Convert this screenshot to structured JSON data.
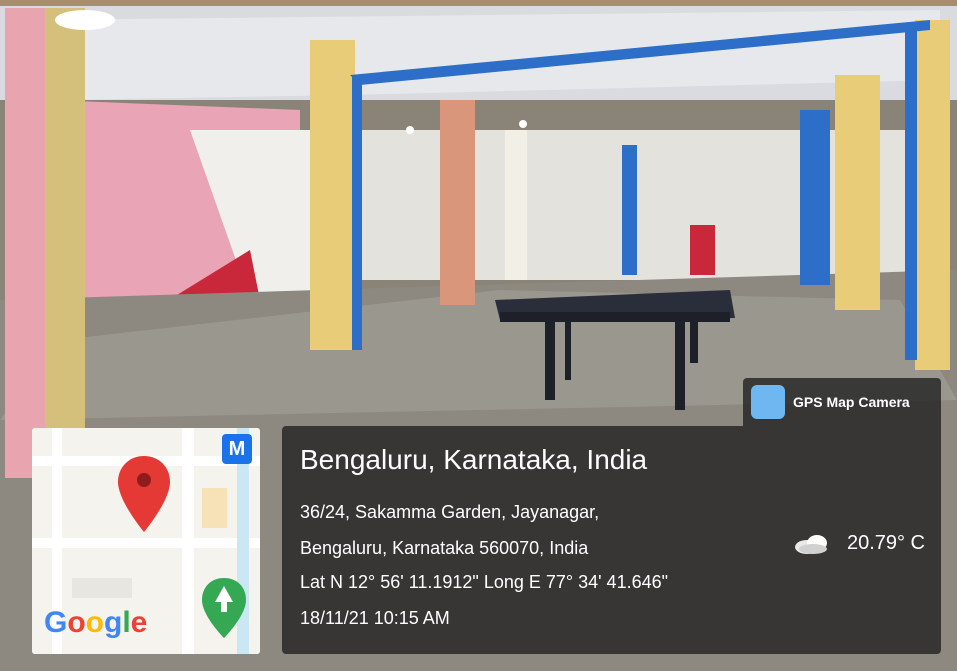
{
  "app_badge": {
    "name": "GPS Map Camera",
    "icon": "gps-map-camera-app-icon"
  },
  "map": {
    "brand": "Google",
    "metro_label": "M",
    "pin_color": "#e53935"
  },
  "location": {
    "title": "Bengaluru, Karnataka, India",
    "address_line1": "36/24, Sakamma Garden, Jayanagar,",
    "address_line2": "Bengaluru, Karnataka 560070, India",
    "coords": "Lat N 12° 56' 11.1912\" Long E 77° 34' 41.646\"",
    "datetime": "18/11/21 10:15 AM"
  },
  "weather": {
    "temperature": "20.79° C",
    "icon": "cloudy-icon"
  },
  "colors": {
    "overlay": "#282828",
    "wall_pink": "#e9a5b5",
    "pillar_yellow": "#e8cc78",
    "pillar_blue": "#2d6fc8",
    "table": "#2a2e3a"
  }
}
